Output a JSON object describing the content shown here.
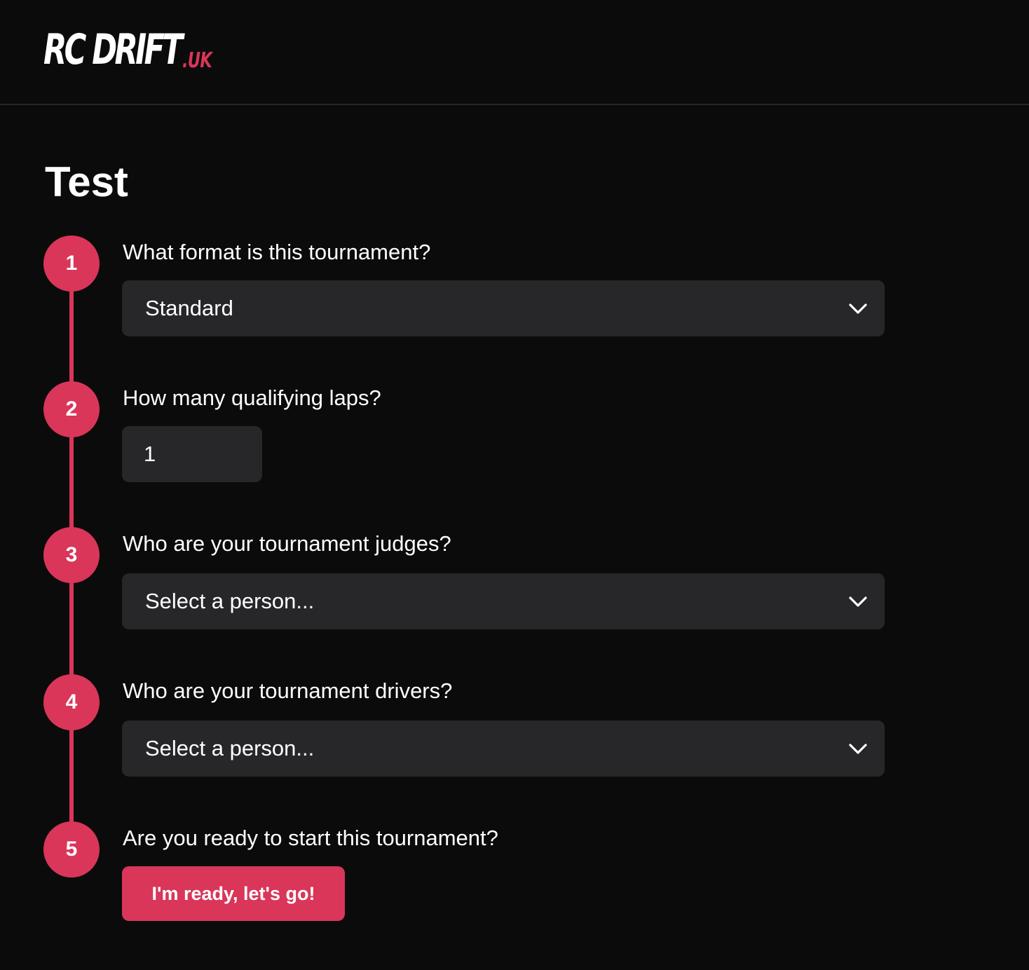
{
  "header": {
    "logo_main": "RC DRIFT",
    "logo_suffix": ".UK"
  },
  "page": {
    "title": "Test"
  },
  "steps": [
    {
      "number": "1",
      "question": "What format is this tournament?",
      "control": "select",
      "value": "Standard"
    },
    {
      "number": "2",
      "question": "How many qualifying laps?",
      "control": "number",
      "value": "1"
    },
    {
      "number": "3",
      "question": "Who are your tournament judges?",
      "control": "select",
      "value": "Select a person..."
    },
    {
      "number": "4",
      "question": "Who are your tournament drivers?",
      "control": "select",
      "value": "Select a person..."
    },
    {
      "number": "5",
      "question": "Are you ready to start this tournament?",
      "control": "button",
      "button_label": "I'm ready, let's go!"
    }
  ],
  "icons": {
    "dropdown": "chevron-down-icon"
  },
  "colors": {
    "background": "#0b0b0b",
    "accent": "#d9365a",
    "field_background": "#27272a",
    "header_border": "#262626",
    "text": "#ffffff"
  }
}
